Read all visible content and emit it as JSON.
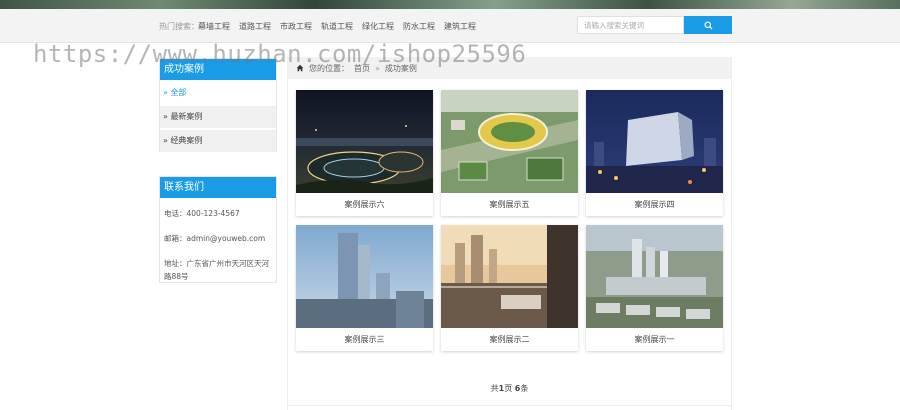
{
  "header": {
    "hot_label": "热门搜索：",
    "hot_links": [
      "幕墙工程",
      "道路工程",
      "市政工程",
      "轨道工程",
      "绿化工程",
      "防水工程",
      "建筑工程"
    ],
    "search_placeholder": "请输入搜索关键词",
    "accent_color": "#1a9be6"
  },
  "watermark": "https://www.huzhan.com/ishop25596",
  "sidebar": {
    "cases_title": "成功案例",
    "cases_items": [
      "» 全部",
      "» 最新案例",
      "» 经典案例"
    ],
    "contact_title": "联系我们",
    "contact_lines": [
      "电话：400-123-4567",
      "邮箱：admin@youweb.com",
      "地址：广东省广州市天河区天河路88号"
    ]
  },
  "main": {
    "breadcrumb": {
      "current_label": "您的位置：",
      "home": "首页",
      "separator": "»",
      "section": "成功案例"
    },
    "cases": [
      {
        "caption": "案例展示六",
        "icon": "night-stadium-photo"
      },
      {
        "caption": "案例展示五",
        "icon": "stadium-aerial-photo"
      },
      {
        "caption": "案例展示四",
        "icon": "city-tower-night-photo"
      },
      {
        "caption": "案例展示三",
        "icon": "skyscraper-photo"
      },
      {
        "caption": "案例展示二",
        "icon": "balcony-view-photo"
      },
      {
        "caption": "案例展示一",
        "icon": "city-aerial-photo"
      }
    ],
    "pager": {
      "prefix": "共",
      "pages": "1",
      "mid": "页 ",
      "count": "6",
      "suffix": "条"
    }
  }
}
